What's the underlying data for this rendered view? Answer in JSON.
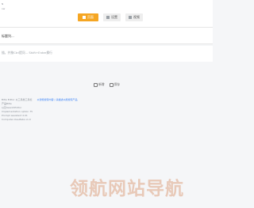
{
  "header": {
    "logo_line1": "N",
    "logo_line2": "ow",
    "toolbar": [
      {
        "label": "页面",
        "active": true
      },
      {
        "label": "设置",
        "active": false
      },
      {
        "label": "视频",
        "active": false
      }
    ]
  },
  "title_row": {
    "text": "标题列..."
  },
  "input_row": {
    "placeholder": "描，并按Ctrl提问... Shift+Enter换行"
  },
  "center_actions": [
    {
      "label": "新增",
      "icon": "doc-icon"
    },
    {
      "label": "保存",
      "icon": "save-icon"
    }
  ],
  "footer": {
    "line1": "Bitle Editor 以工具类工具栏",
    "line1_link": "以智能搜索内容 | 请描述以能搜索产品",
    "line2": "产品Bitle",
    "line3": "以及SearchEditor",
    "line4": "Implementation option 75",
    "line5": "Prompt assistant 4.01",
    "line6": "Computer-Use-Beta v1.0"
  },
  "watermark": {
    "text": "领航网站导航"
  }
}
